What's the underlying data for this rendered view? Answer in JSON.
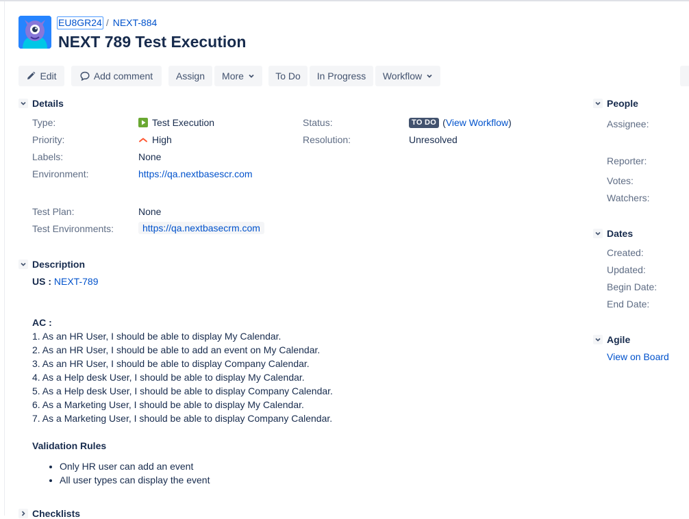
{
  "header": {
    "project_key": "EU8GR24",
    "parent_key": "NEXT-884",
    "title": "NEXT 789 Test Execution"
  },
  "toolbar": {
    "edit": "Edit",
    "add_comment": "Add comment",
    "assign": "Assign",
    "more": "More",
    "to_do": "To Do",
    "in_progress": "In Progress",
    "workflow": "Workflow"
  },
  "details": {
    "heading": "Details",
    "type_label": "Type:",
    "type_value": "Test Execution",
    "priority_label": "Priority:",
    "priority_value": "High",
    "labels_label": "Labels:",
    "labels_value": "None",
    "environment_label": "Environment:",
    "environment_value": "https://qa.nextbasescr.com",
    "status_label": "Status:",
    "status_value": "TO DO",
    "status_open": "(",
    "view_workflow": "View Workflow",
    "status_close": ")",
    "resolution_label": "Resolution:",
    "resolution_value": "Unresolved",
    "test_plan_label": "Test Plan:",
    "test_plan_value": "None",
    "test_env_label": "Test Environments:",
    "test_env_value": "https://qa.nextbasecrm.com"
  },
  "description": {
    "heading": "Description",
    "us_label": "US :",
    "us_link": "NEXT-789",
    "ac_label": "AC :",
    "ac_items": [
      "1. As an HR User, I should be able to display My Calendar.",
      "2. As an HR User, I should be able to add an event on My Calendar.",
      "3. As an HR User, I should be able to display Company Calendar.",
      "4. As a Help desk User, I should be able to display My Calendar.",
      "5. As a Help desk User, I should be able to display Company Calendar.",
      "6. As a Marketing User, I should be able to display My Calendar.",
      "7. As a Marketing User, I should be able to display Company Calendar."
    ],
    "validation_heading": "Validation Rules",
    "validation_items": [
      "Only HR user can add an event",
      "All user types can display the event"
    ]
  },
  "checklists": {
    "heading": "Checklists"
  },
  "people": {
    "heading": "People",
    "assignee": "Assignee:",
    "reporter": "Reporter:",
    "votes": "Votes:",
    "watchers": "Watchers:"
  },
  "dates": {
    "heading": "Dates",
    "created": "Created:",
    "updated": "Updated:",
    "begin_date": "Begin Date:",
    "end_date": "End Date:"
  },
  "agile": {
    "heading": "Agile",
    "view_on_board": "View on Board"
  },
  "colors": {
    "link": "#0052cc",
    "lozenge_bg": "#42526e",
    "priority_high": "#ff5630",
    "type_icon": "#6aa832",
    "button_bg": "#f4f5f7"
  },
  "icons": [
    "project-avatar-icon",
    "pencil-icon",
    "comment-icon",
    "chevron-down-icon",
    "test-execution-icon",
    "priority-high-icon"
  ]
}
